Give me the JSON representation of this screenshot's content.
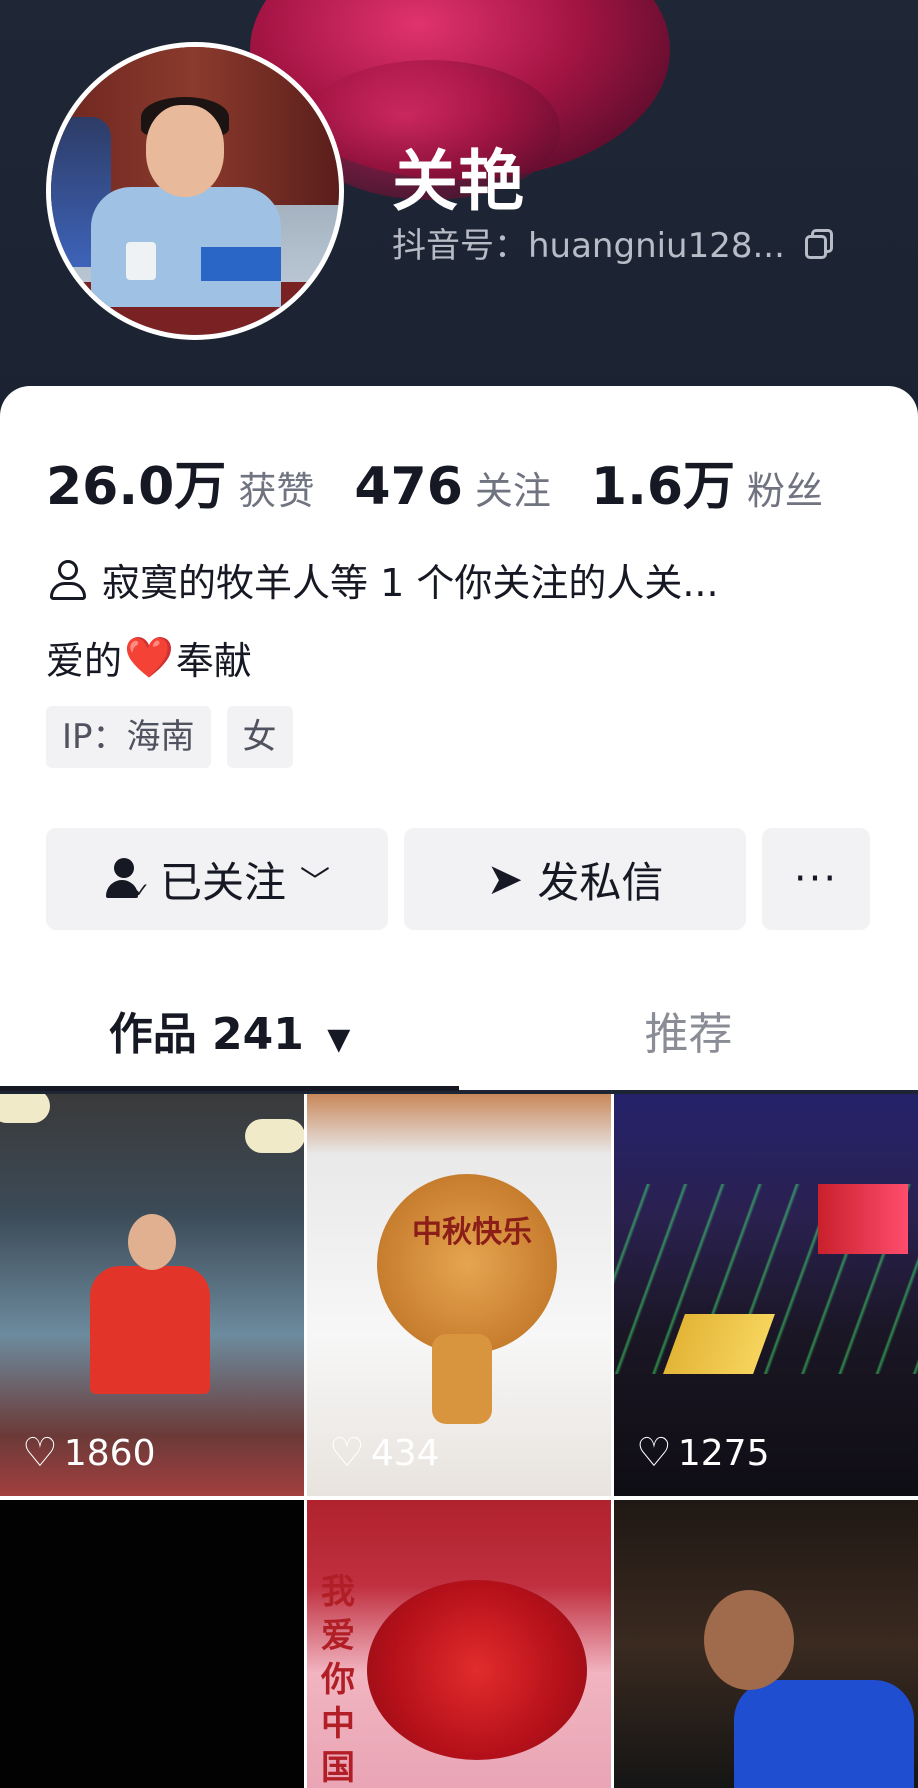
{
  "profile": {
    "name": "关艳",
    "douyin_id": "抖音号：huangniu128..."
  },
  "stats": [
    {
      "value": "26.0万",
      "label": "获赞"
    },
    {
      "value": "476",
      "label": "关注"
    },
    {
      "value": "1.6万",
      "label": "粉丝"
    }
  ],
  "mutual_followers": "寂寞的牧羊人等 1 个你关注的人关...",
  "bio": {
    "before": "爱的",
    "emoji": "❤️",
    "after": "奉献"
  },
  "tags": [
    "IP：海南",
    "女"
  ],
  "actions": {
    "follow_label": "已关注",
    "message_label": "发私信",
    "more_label": "···"
  },
  "tabs": {
    "works_label": "作品 241",
    "recommend_label": "推荐"
  },
  "videos": [
    {
      "likes": "1860"
    },
    {
      "likes": "434",
      "overlay_text": "中秋快乐"
    },
    {
      "likes": "1275"
    },
    {},
    {
      "overlay_text": "我爱你中国"
    },
    {}
  ],
  "colors": {
    "header_bg": "#1d2535",
    "text_primary": "#161823",
    "text_secondary": "#707380",
    "button_bg": "#f2f2f4",
    "heart_red": "#e5283c"
  }
}
